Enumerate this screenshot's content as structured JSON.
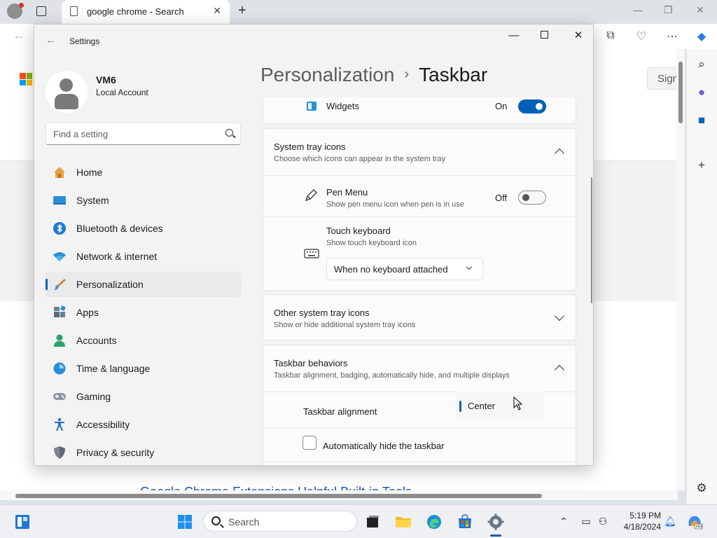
{
  "browser": {
    "tab_title": "google chrome - Search",
    "close_glyph": "✕",
    "newtab_glyph": "+",
    "minimize_glyph": "—",
    "restore_glyph": "❐",
    "close_win_glyph": "✕",
    "back_glyph": "←",
    "signin_label": "Sign",
    "bottom_link_text": "Google Chrome Extensions        Helpful Built-in Tools"
  },
  "settings": {
    "window_title": "Settings",
    "back_glyph": "←",
    "minimize_glyph": "—",
    "close_glyph": "✕",
    "user": {
      "name": "VM6",
      "account_type": "Local Account"
    },
    "search": {
      "placeholder": "Find a setting"
    },
    "nav": [
      {
        "label": "Home",
        "icon": "home-icon"
      },
      {
        "label": "System",
        "icon": "system-icon"
      },
      {
        "label": "Bluetooth & devices",
        "icon": "bluetooth-icon"
      },
      {
        "label": "Network & internet",
        "icon": "network-icon"
      },
      {
        "label": "Personalization",
        "icon": "brush-icon",
        "selected": true
      },
      {
        "label": "Apps",
        "icon": "apps-icon"
      },
      {
        "label": "Accounts",
        "icon": "accounts-icon"
      },
      {
        "label": "Time & language",
        "icon": "time-language-icon"
      },
      {
        "label": "Gaming",
        "icon": "gaming-icon"
      },
      {
        "label": "Accessibility",
        "icon": "accessibility-icon"
      },
      {
        "label": "Privacy & security",
        "icon": "shield-icon"
      }
    ],
    "breadcrumb": {
      "parent": "Personalization",
      "separator": "›",
      "current": "Taskbar"
    },
    "widgets": {
      "label": "Widgets",
      "state": "On"
    },
    "system_tray": {
      "title": "System tray icons",
      "subtitle": "Choose which icons can appear in the system tray",
      "pen_menu": {
        "title": "Pen Menu",
        "subtitle": "Show pen menu icon when pen is in use",
        "state": "Off"
      },
      "touch_keyboard": {
        "title": "Touch keyboard",
        "subtitle": "Show touch keyboard icon",
        "dropdown_value": "When no keyboard attached"
      }
    },
    "other_tray": {
      "title": "Other system tray icons",
      "subtitle": "Show or hide additional system tray icons"
    },
    "behaviors": {
      "title": "Taskbar behaviors",
      "subtitle": "Taskbar alignment, badging, automatically hide, and multiple displays",
      "alignment_label": "Taskbar alignment",
      "alignment_value": "Center",
      "autohide_label": "Automatically hide the taskbar"
    }
  },
  "taskbar": {
    "search_label": "Search",
    "time": "5:19 PM",
    "date": "4/18/2024"
  },
  "colors": {
    "accent": "#005fb8"
  }
}
